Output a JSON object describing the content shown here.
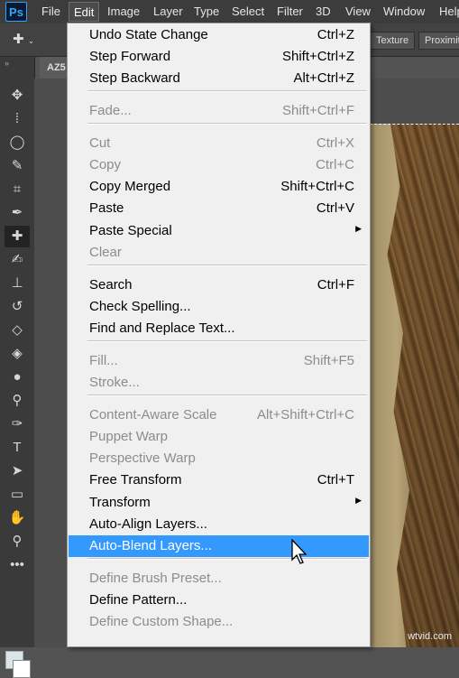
{
  "app": {
    "logo": "Ps"
  },
  "menubar": {
    "items": [
      "File",
      "Edit",
      "Image",
      "Layer",
      "Type",
      "Select",
      "Filter",
      "3D",
      "View",
      "Window",
      "Help"
    ],
    "active": "Edit"
  },
  "options": {
    "tool_icon": "spot-healing-brush-icon",
    "buttons": [
      "Texture",
      "Proximity"
    ]
  },
  "document": {
    "tab_label": "AZ5"
  },
  "edit_menu": {
    "items": [
      {
        "label": "Undo State Change",
        "shortcut": "Ctrl+Z",
        "enabled": true
      },
      {
        "label": "Step Forward",
        "shortcut": "Shift+Ctrl+Z",
        "enabled": true
      },
      {
        "label": "Step Backward",
        "shortcut": "Alt+Ctrl+Z",
        "enabled": true
      },
      {
        "label": "Fade...",
        "shortcut": "Shift+Ctrl+F",
        "enabled": false
      },
      {
        "label": "Cut",
        "shortcut": "Ctrl+X",
        "enabled": false
      },
      {
        "label": "Copy",
        "shortcut": "Ctrl+C",
        "enabled": false
      },
      {
        "label": "Copy Merged",
        "shortcut": "Shift+Ctrl+C",
        "enabled": true
      },
      {
        "label": "Paste",
        "shortcut": "Ctrl+V",
        "enabled": true
      },
      {
        "label": "Paste Special",
        "shortcut": "",
        "enabled": true,
        "submenu": true
      },
      {
        "label": "Clear",
        "shortcut": "",
        "enabled": false
      },
      {
        "label": "Search",
        "shortcut": "Ctrl+F",
        "enabled": true
      },
      {
        "label": "Check Spelling...",
        "shortcut": "",
        "enabled": true
      },
      {
        "label": "Find and Replace Text...",
        "shortcut": "",
        "enabled": true
      },
      {
        "label": "Fill...",
        "shortcut": "Shift+F5",
        "enabled": false
      },
      {
        "label": "Stroke...",
        "shortcut": "",
        "enabled": false
      },
      {
        "label": "Content-Aware Scale",
        "shortcut": "Alt+Shift+Ctrl+C",
        "enabled": false
      },
      {
        "label": "Puppet Warp",
        "shortcut": "",
        "enabled": false
      },
      {
        "label": "Perspective Warp",
        "shortcut": "",
        "enabled": false
      },
      {
        "label": "Free Transform",
        "shortcut": "Ctrl+T",
        "enabled": true
      },
      {
        "label": "Transform",
        "shortcut": "",
        "enabled": true,
        "submenu": true
      },
      {
        "label": "Auto-Align Layers...",
        "shortcut": "",
        "enabled": true
      },
      {
        "label": "Auto-Blend Layers...",
        "shortcut": "",
        "enabled": true,
        "highlighted": true
      },
      {
        "label": "Define Brush Preset...",
        "shortcut": "",
        "enabled": false
      },
      {
        "label": "Define Pattern...",
        "shortcut": "",
        "enabled": true
      },
      {
        "label": "Define Custom Shape...",
        "shortcut": "",
        "enabled": false
      }
    ],
    "highlight_color": "#3399ff"
  },
  "watermark": "wtvid.com",
  "toolbar": {
    "tools": [
      "move-icon",
      "marquee-icon",
      "lasso-icon",
      "quick-selection-icon",
      "crop-icon",
      "eyedropper-icon",
      "spot-healing-brush-icon",
      "brush-icon",
      "clone-stamp-icon",
      "history-brush-icon",
      "eraser-icon",
      "paint-bucket-icon",
      "blur-icon",
      "dodge-icon",
      "pen-icon",
      "type-icon",
      "path-selection-icon",
      "rectangle-icon",
      "hand-icon",
      "zoom-icon",
      "more-tools-icon"
    ],
    "active_tool": "spot-healing-brush-icon",
    "glyphs": [
      "✥",
      "⁞",
      "◯",
      "✎",
      "⌗",
      "✒",
      "✚",
      "✍",
      "⊥",
      "↺",
      "◇",
      "◈",
      "●",
      "⚲",
      "✑",
      "T",
      "➤",
      "▭",
      "✋",
      "⚲",
      "•••"
    ]
  },
  "colors": {
    "foreground": "#d8e6e8",
    "background": "#ffffff"
  }
}
